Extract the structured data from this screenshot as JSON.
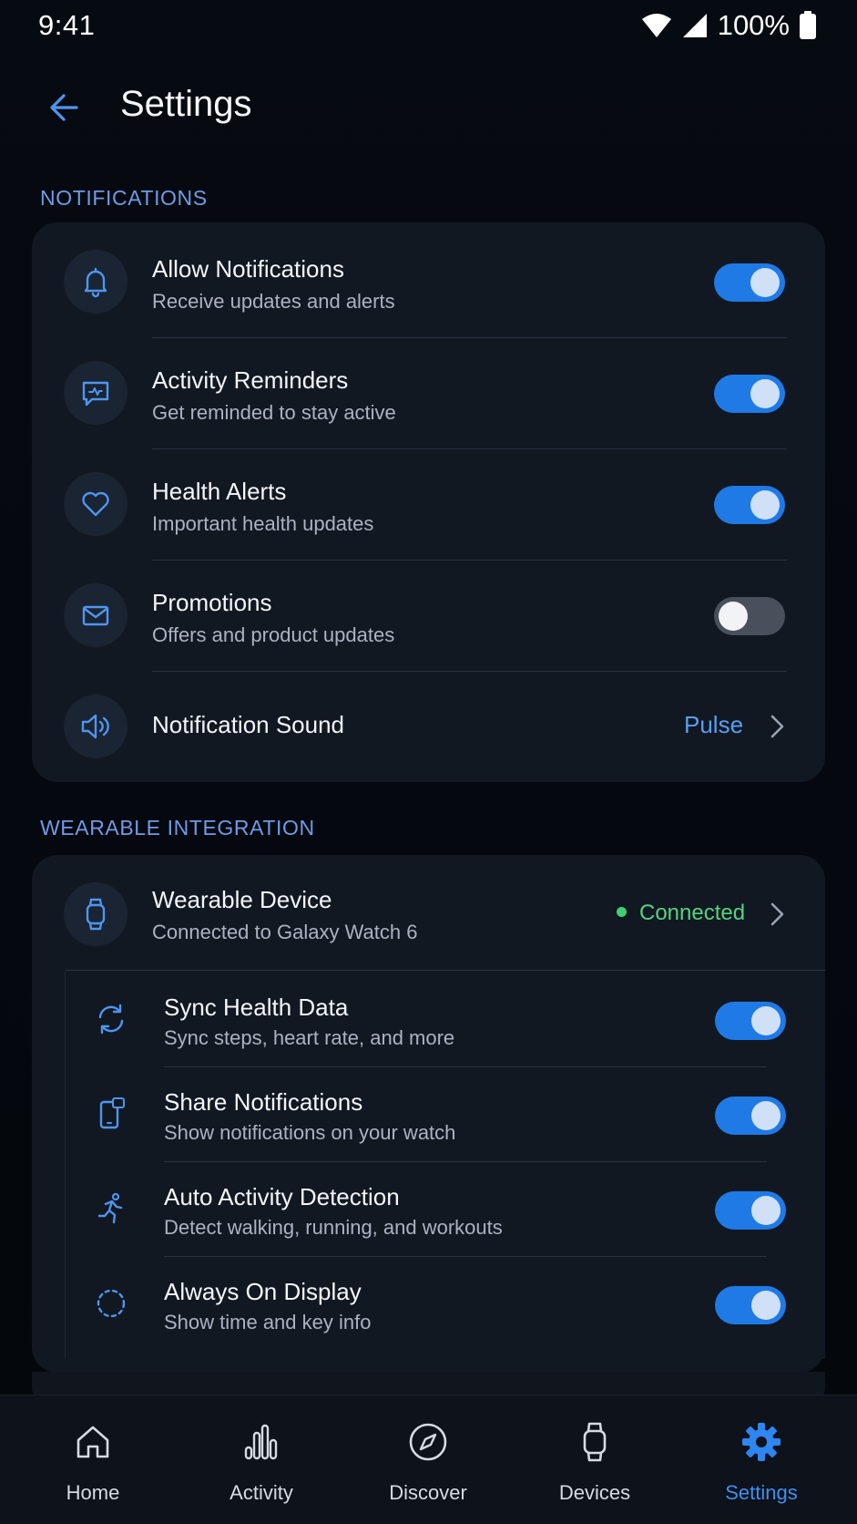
{
  "status_bar": {
    "time": "9:41",
    "battery": "100%"
  },
  "header": {
    "title": "Settings"
  },
  "notifications": {
    "section_label": "NOTIFICATIONS",
    "items": [
      {
        "title": "Allow Notifications",
        "subtitle": "Receive updates and alerts",
        "icon": "bell-icon",
        "enabled": true
      },
      {
        "title": "Activity Reminders",
        "subtitle": "Get reminded to stay active",
        "icon": "chat-activity-icon",
        "enabled": true
      },
      {
        "title": "Health Alerts",
        "subtitle": "Important health updates",
        "icon": "heart-icon",
        "enabled": true
      },
      {
        "title": "Promotions",
        "subtitle": "Offers and product updates",
        "icon": "mail-icon",
        "enabled": false
      }
    ],
    "sound": {
      "title": "Notification Sound",
      "value": "Pulse",
      "icon": "speaker-icon"
    }
  },
  "wearable": {
    "section_label": "WEARABLE INTEGRATION",
    "device": {
      "title": "Wearable Device",
      "subtitle": "Connected to Galaxy Watch 6",
      "status": "Connected",
      "icon": "watch-icon"
    },
    "items": [
      {
        "title": "Sync Health Data",
        "subtitle": "Sync steps, heart rate, and more",
        "icon": "sync-icon",
        "enabled": true
      },
      {
        "title": "Share Notifications",
        "subtitle": "Show notifications on your watch",
        "icon": "phone-notification-icon",
        "enabled": true
      },
      {
        "title": "Auto Activity Detection",
        "subtitle": "Detect walking, running, and workouts",
        "icon": "running-icon",
        "enabled": true
      },
      {
        "title": "Always On Display",
        "subtitle": "Show time and key info",
        "icon": "dotted-circle-icon",
        "enabled": true
      }
    ]
  },
  "bottom_nav": {
    "items": [
      {
        "label": "Home",
        "icon": "home-icon"
      },
      {
        "label": "Activity",
        "icon": "activity-bars-icon"
      },
      {
        "label": "Discover",
        "icon": "compass-icon"
      },
      {
        "label": "Devices",
        "icon": "watch-icon"
      },
      {
        "label": "Settings",
        "icon": "gear-icon"
      }
    ],
    "active": "Settings"
  },
  "colors": {
    "accent": "#1f7ae6",
    "link": "#5a9ef0",
    "section": "#6f9be6",
    "connected": "#55d37f"
  }
}
